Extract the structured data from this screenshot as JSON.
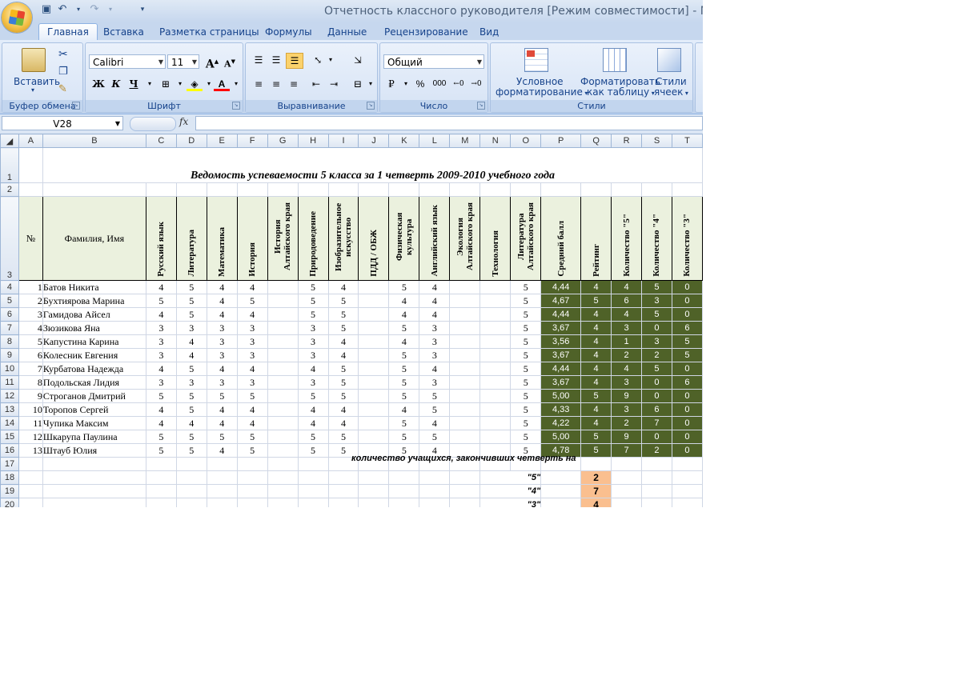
{
  "window": {
    "title": "Отчетность классного руководителя  [Режим совместимости] - Microsoft Excel"
  },
  "tabs": [
    "Главная",
    "Вставка",
    "Разметка страницы",
    "Формулы",
    "Данные",
    "Рецензирование",
    "Вид"
  ],
  "ribbon": {
    "clipboard": {
      "label": "Буфер обмена",
      "paste": "Вставить"
    },
    "font": {
      "label": "Шрифт",
      "name": "Calibri",
      "size": "11",
      "bold": "Ж",
      "italic": "К",
      "underline": "Ч",
      "grow": "A",
      "shrink": "A"
    },
    "alignment": {
      "label": "Выравнивание"
    },
    "number": {
      "label": "Число",
      "format": "Общий",
      "percent": "%",
      "thousands": "000"
    },
    "styles": {
      "label": "Стили",
      "conditional1": "Условное",
      "conditional2": "форматирование",
      "table1": "Форматировать",
      "table2": "как таблицу",
      "cell1": "Стили",
      "cell2": "ячеек"
    }
  },
  "formula_bar": {
    "name_box": "V28",
    "fx": "fx",
    "formula": ""
  },
  "sheet": {
    "columns": [
      "A",
      "B",
      "C",
      "D",
      "E",
      "F",
      "G",
      "H",
      "I",
      "J",
      "K",
      "L",
      "M",
      "N",
      "O",
      "P",
      "Q",
      "R",
      "S",
      "T"
    ],
    "title": "Ведомость успеваемости 5 класса за 1 четверть 2009-2010 учебного года",
    "header": {
      "num": "№",
      "name": "Фамилия, Имя",
      "subjects": [
        "Русский язык",
        "Литература",
        "Математика",
        "История",
        "История Алтайского края",
        "Природоведение",
        "Изобразительное искусство",
        "ПДД / ОБЖ",
        "Физическая культура",
        "Английский язык",
        "Экология Алтайского края",
        "Технология",
        "Литература Алтайского края",
        "Средний балл",
        "Рейтинг",
        "Количество \"5\"",
        "Количество \"4\"",
        "Количество \"3\""
      ]
    },
    "rows": [
      {
        "n": "1",
        "name": "Батов Никита",
        "g": [
          "4",
          "5",
          "4",
          "4",
          "",
          "5",
          "4",
          "",
          "5",
          "4",
          "",
          "",
          "5"
        ],
        "avg": "4,44",
        "rating": "4",
        "c5": "4",
        "c4": "5",
        "c3": "0"
      },
      {
        "n": "2",
        "name": "Бухтиярова Марина",
        "g": [
          "5",
          "5",
          "4",
          "5",
          "",
          "5",
          "5",
          "",
          "4",
          "4",
          "",
          "",
          "5"
        ],
        "avg": "4,67",
        "rating": "5",
        "c5": "6",
        "c4": "3",
        "c3": "0"
      },
      {
        "n": "3",
        "name": "Гамидова Айсел",
        "g": [
          "4",
          "5",
          "4",
          "4",
          "",
          "5",
          "5",
          "",
          "4",
          "4",
          "",
          "",
          "5"
        ],
        "avg": "4,44",
        "rating": "4",
        "c5": "4",
        "c4": "5",
        "c3": "0"
      },
      {
        "n": "4",
        "name": "Зюзикова Яна",
        "g": [
          "3",
          "3",
          "3",
          "3",
          "",
          "3",
          "5",
          "",
          "5",
          "3",
          "",
          "",
          "5"
        ],
        "avg": "3,67",
        "rating": "4",
        "c5": "3",
        "c4": "0",
        "c3": "6"
      },
      {
        "n": "5",
        "name": "Капустина Карина",
        "g": [
          "3",
          "4",
          "3",
          "3",
          "",
          "3",
          "4",
          "",
          "4",
          "3",
          "",
          "",
          "5"
        ],
        "avg": "3,56",
        "rating": "4",
        "c5": "1",
        "c4": "3",
        "c3": "5"
      },
      {
        "n": "6",
        "name": "Колесник Евгения",
        "g": [
          "3",
          "4",
          "3",
          "3",
          "",
          "3",
          "4",
          "",
          "5",
          "3",
          "",
          "",
          "5"
        ],
        "avg": "3,67",
        "rating": "4",
        "c5": "2",
        "c4": "2",
        "c3": "5"
      },
      {
        "n": "7",
        "name": "Курбатова Надежда",
        "g": [
          "4",
          "5",
          "4",
          "4",
          "",
          "4",
          "5",
          "",
          "5",
          "4",
          "",
          "",
          "5"
        ],
        "avg": "4,44",
        "rating": "4",
        "c5": "4",
        "c4": "5",
        "c3": "0"
      },
      {
        "n": "8",
        "name": "Подольская Лидия",
        "g": [
          "3",
          "3",
          "3",
          "3",
          "",
          "3",
          "5",
          "",
          "5",
          "3",
          "",
          "",
          "5"
        ],
        "avg": "3,67",
        "rating": "4",
        "c5": "3",
        "c4": "0",
        "c3": "6"
      },
      {
        "n": "9",
        "name": "Строганов Дмитрий",
        "g": [
          "5",
          "5",
          "5",
          "5",
          "",
          "5",
          "5",
          "",
          "5",
          "5",
          "",
          "",
          "5"
        ],
        "avg": "5,00",
        "rating": "5",
        "c5": "9",
        "c4": "0",
        "c3": "0"
      },
      {
        "n": "10",
        "name": "Торопов Сергей",
        "g": [
          "4",
          "5",
          "4",
          "4",
          "",
          "4",
          "4",
          "",
          "4",
          "5",
          "",
          "",
          "5"
        ],
        "avg": "4,33",
        "rating": "4",
        "c5": "3",
        "c4": "6",
        "c3": "0"
      },
      {
        "n": "11",
        "name": "Чупика Максим",
        "g": [
          "4",
          "4",
          "4",
          "4",
          "",
          "4",
          "4",
          "",
          "5",
          "4",
          "",
          "",
          "5"
        ],
        "avg": "4,22",
        "rating": "4",
        "c5": "2",
        "c4": "7",
        "c3": "0"
      },
      {
        "n": "12",
        "name": "Шкарупа Паулина",
        "g": [
          "5",
          "5",
          "5",
          "5",
          "",
          "5",
          "5",
          "",
          "5",
          "5",
          "",
          "",
          "5"
        ],
        "avg": "5,00",
        "rating": "5",
        "c5": "9",
        "c4": "0",
        "c3": "0"
      },
      {
        "n": "13",
        "name": "Штауб Юлия",
        "g": [
          "5",
          "5",
          "4",
          "5",
          "",
          "5",
          "5",
          "",
          "5",
          "4",
          "",
          "",
          "5"
        ],
        "avg": "4,78",
        "rating": "5",
        "c5": "7",
        "c4": "2",
        "c3": "0"
      }
    ],
    "summary": {
      "note": "количество учащихся, закончивших четверть на",
      "grades": [
        {
          "label": "\"5\"",
          "value": "2"
        },
        {
          "label": "\"4\"",
          "value": "7"
        },
        {
          "label": "\"3\"",
          "value": "4"
        }
      ]
    }
  }
}
